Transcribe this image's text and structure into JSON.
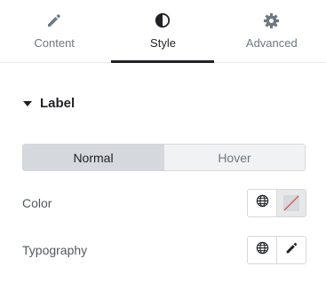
{
  "tabs": [
    {
      "label": "Content",
      "icon": "pencil-icon",
      "active": false
    },
    {
      "label": "Style",
      "icon": "half-circle-icon",
      "active": true
    },
    {
      "label": "Advanced",
      "icon": "gear-icon",
      "active": false
    }
  ],
  "section": {
    "title": "Label",
    "expanded": true
  },
  "states": {
    "normal": "Normal",
    "hover": "Hover",
    "active": "Normal"
  },
  "controls": {
    "color": {
      "label": "Color",
      "global_icon": "globe-icon",
      "value_icon": "empty-color-swatch-icon"
    },
    "typography": {
      "label": "Typography",
      "global_icon": "globe-icon",
      "edit_icon": "pencil-icon"
    }
  },
  "colors": {
    "accent_dark": "#1f2124",
    "muted_text": "#6d7882",
    "border": "#d5d8dc",
    "swatch_slash": "#e0403a"
  }
}
